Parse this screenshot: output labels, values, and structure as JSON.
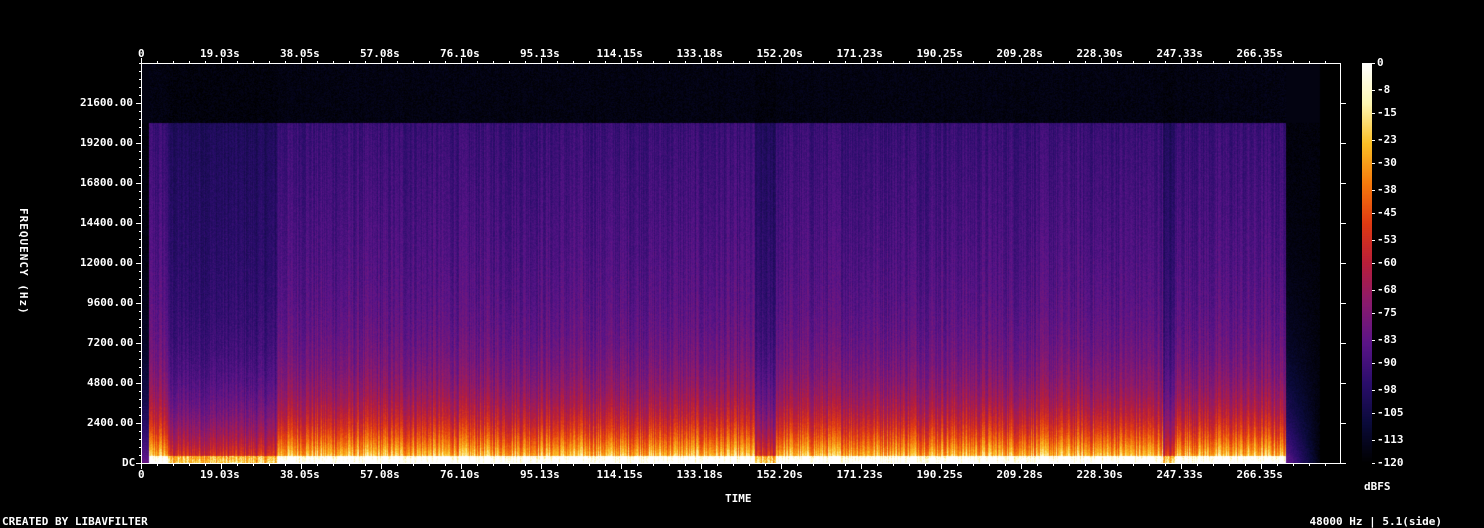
{
  "chart_data": {
    "type": "heatmap",
    "xlabel": "TIME",
    "ylabel": "FREQUENCY (Hz)",
    "x_ticks": [
      "0",
      "19.03s",
      "38.05s",
      "57.08s",
      "76.10s",
      "95.13s",
      "114.15s",
      "133.18s",
      "152.20s",
      "171.23s",
      "190.25s",
      "209.28s",
      "228.30s",
      "247.33s",
      "266.35s"
    ],
    "x_tick_values": [
      0,
      19.03,
      38.05,
      57.08,
      76.1,
      95.13,
      114.15,
      133.18,
      152.2,
      171.23,
      190.25,
      209.28,
      228.3,
      247.33,
      266.35
    ],
    "xlim": [
      0,
      285.4
    ],
    "y_ticks": [
      "DC",
      "2400.00",
      "4800.00",
      "7200.00",
      "9600.00",
      "12000.00",
      "14400.00",
      "16800.00",
      "19200.00",
      "21600.00"
    ],
    "y_tick_values": [
      0,
      2400,
      4800,
      7200,
      9600,
      12000,
      14400,
      16800,
      19200,
      21600
    ],
    "ylim": [
      0,
      24000
    ],
    "colorbar": {
      "label": "dBFS",
      "ticks": [
        "0",
        "-8",
        "-15",
        "-23",
        "-30",
        "-38",
        "-45",
        "-53",
        "-60",
        "-68",
        "-75",
        "-83",
        "-90",
        "-98",
        "-105",
        "-113",
        "-120"
      ],
      "tick_values": [
        0,
        -8,
        -15,
        -23,
        -30,
        -38,
        -45,
        -53,
        -60,
        -68,
        -75,
        -83,
        -90,
        -98,
        -105,
        -113,
        -120
      ],
      "range": [
        -120,
        0
      ]
    },
    "signal_cutoff_hz": 20500,
    "audio_start_s": 1.5,
    "audio_end_s": 272.5,
    "quiet_sections_s": [
      [
        6,
        32
      ],
      [
        146,
        151
      ],
      [
        243,
        246
      ]
    ],
    "colormap": [
      "#000000",
      "#0a0a3a",
      "#2a0d6b",
      "#5a1488",
      "#8a1a6e",
      "#b81e3a",
      "#e03a12",
      "#f57a0c",
      "#fbbf26",
      "#fdf7b3",
      "#ffffff"
    ]
  },
  "footer": {
    "credit": "CREATED BY LIBAVFILTER",
    "format": "48000 Hz | 5.1(side)"
  }
}
